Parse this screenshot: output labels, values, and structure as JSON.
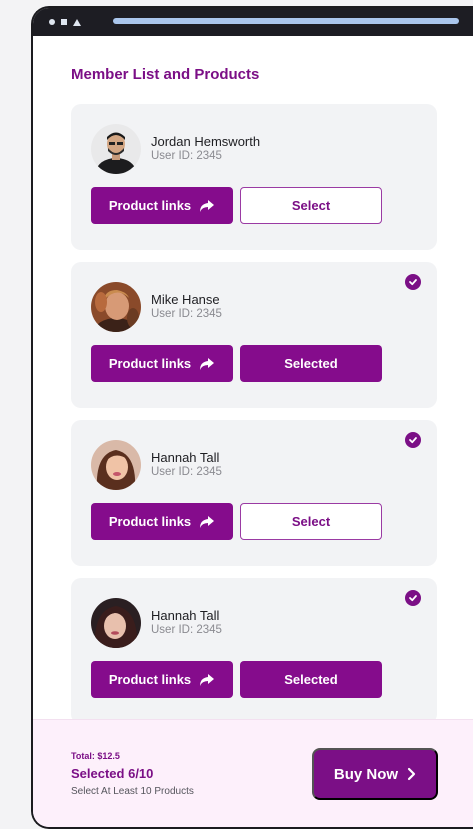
{
  "header": {
    "title": "Member List and Products"
  },
  "members": [
    {
      "name": "Jordan Hemsworth",
      "user_id": "User ID: 2345",
      "links_label": "Product links",
      "select_label": "Select",
      "selected": false
    },
    {
      "name": "Mike Hanse",
      "user_id": "User ID: 2345",
      "links_label": "Product links",
      "select_label": "Selected",
      "selected": true
    },
    {
      "name": "Hannah Tall",
      "user_id": "User ID: 2345",
      "links_label": "Product links",
      "select_label": "Select",
      "selected": false
    },
    {
      "name": "Hannah Tall",
      "user_id": "User ID: 2345",
      "links_label": "Product links",
      "select_label": "Selected",
      "selected": true
    }
  ],
  "footer": {
    "total": "Total: $12.5",
    "selected": "Selected 6/10",
    "hint": "Select At Least 10 Products",
    "buy_label": "Buy Now"
  },
  "colors": {
    "primary": "#850c8c",
    "card_bg": "#f2f3f5",
    "footer_bg": "#fdf0fb"
  },
  "icons": [
    "share-arrow-icon",
    "check-circle-icon",
    "chevron-right-icon"
  ]
}
